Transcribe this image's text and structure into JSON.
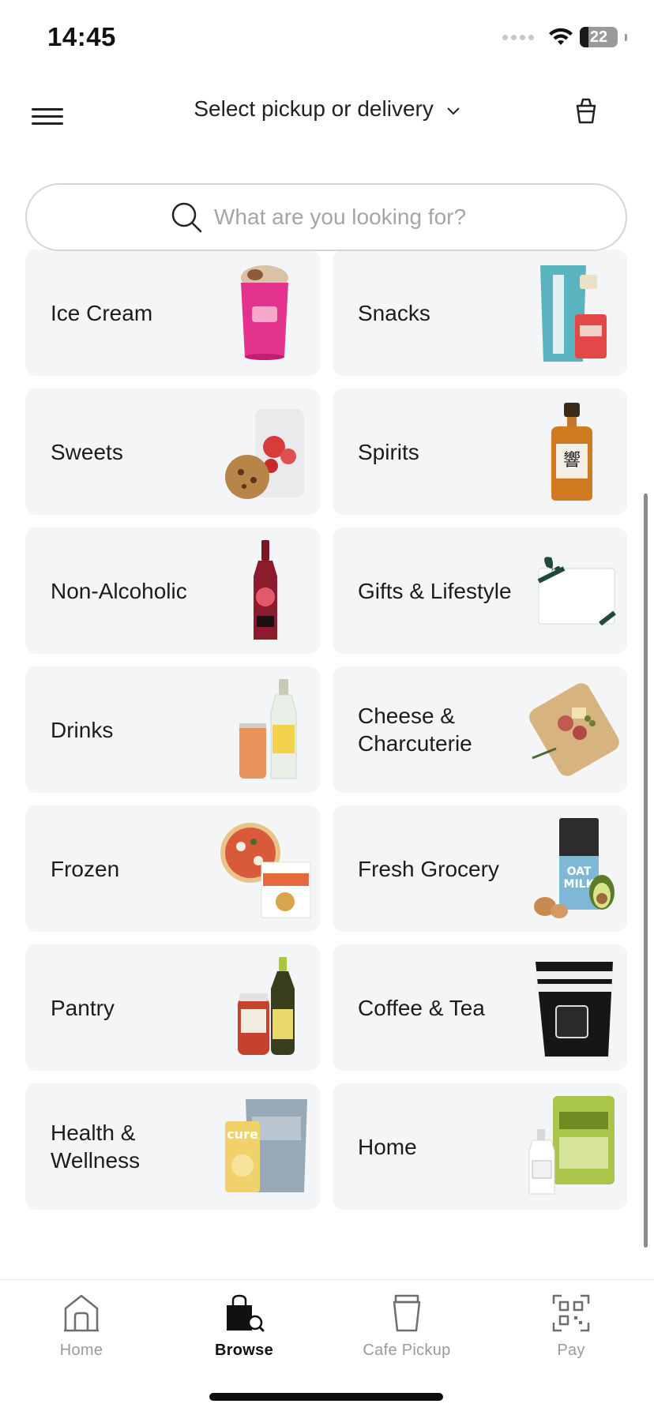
{
  "status_bar": {
    "time": "14:45",
    "battery": "22",
    "battery_level": 0.22
  },
  "header": {
    "title": "Select pickup or delivery"
  },
  "search": {
    "placeholder": "What are you looking for?"
  },
  "categories": [
    {
      "label": "",
      "icon": "bottles-image"
    },
    {
      "label": "",
      "icon": "jar-image"
    },
    {
      "label": "Ice Cream",
      "icon": "ice-cream-pint-image"
    },
    {
      "label": "Snacks",
      "icon": "chips-bag-image"
    },
    {
      "label": "Sweets",
      "icon": "cookie-candy-image"
    },
    {
      "label": "Spirits",
      "icon": "whisky-bottle-image"
    },
    {
      "label": "Non-Alcoholic",
      "icon": "soda-bottle-image"
    },
    {
      "label": "Gifts & Lifestyle",
      "icon": "gift-box-image"
    },
    {
      "label": "Drinks",
      "icon": "can-and-bottle-image"
    },
    {
      "label": "Cheese & Charcuterie",
      "icon": "charcuterie-board-image"
    },
    {
      "label": "Frozen",
      "icon": "pizza-nuggets-image"
    },
    {
      "label": "Fresh Grocery",
      "icon": "oat-milk-eggs-image"
    },
    {
      "label": "Pantry",
      "icon": "sauce-oil-image"
    },
    {
      "label": "Coffee & Tea",
      "icon": "coffee-bag-image"
    },
    {
      "label": "Health & Wellness",
      "icon": "supplement-pouches-image"
    },
    {
      "label": "Home",
      "icon": "cleaning-spray-image"
    }
  ],
  "tabbar": {
    "tabs": [
      {
        "label": "Home",
        "icon": "home-icon",
        "active": false
      },
      {
        "label": "Browse",
        "icon": "browse-bag-icon",
        "active": true
      },
      {
        "label": "Cafe Pickup",
        "icon": "cup-icon",
        "active": false
      },
      {
        "label": "Pay",
        "icon": "qr-code-icon",
        "active": false
      }
    ]
  },
  "colors": {
    "tile_bg": "#f4f5f6",
    "active_tab": "#111111",
    "inactive_tab": "#9a9a9a"
  }
}
